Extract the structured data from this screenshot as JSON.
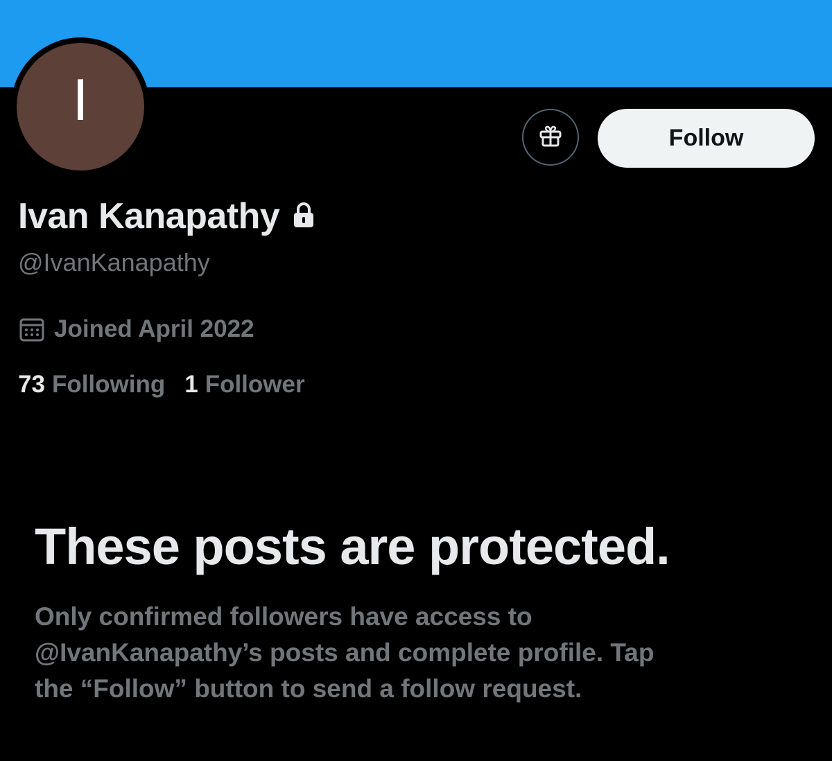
{
  "profile": {
    "avatar_letter": "I",
    "avatar_color": "#5d4037",
    "banner_color": "#1d9bf0",
    "display_name": "Ivan Kanapathy",
    "handle": "@IvanKanapathy",
    "joined": "Joined April 2022",
    "following_count": "73",
    "following_label": "Following",
    "followers_count": "1",
    "followers_label": "Follower",
    "name_icon": "lock-icon",
    "joined_icon": "calendar-icon"
  },
  "actions": {
    "gift_icon": "gift-icon",
    "follow_label": "Follow"
  },
  "protected": {
    "title": "These posts are protected.",
    "body": "Only confirmed followers have access to\n@IvanKanapathy’s posts and complete profile. Tap\nthe “Follow” button to send a follow request."
  }
}
